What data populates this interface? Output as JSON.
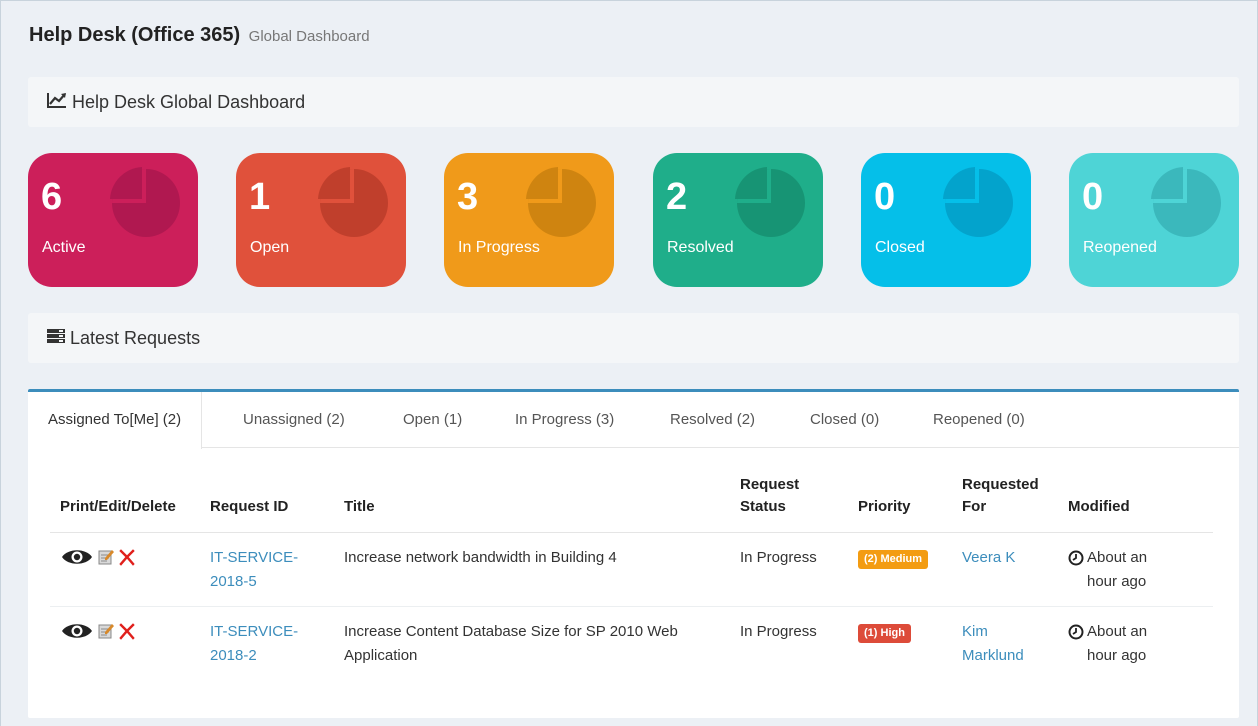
{
  "header": {
    "title": "Help Desk (Office 365)",
    "subtitle": "Global Dashboard"
  },
  "dashboard_section": {
    "title": "Help Desk Global Dashboard",
    "icon": "line-chart-icon"
  },
  "tiles": [
    {
      "count": "6",
      "label": "Active",
      "color": "#cc1f5a",
      "pie_color": "#b01850"
    },
    {
      "count": "1",
      "label": "Open",
      "color": "#e0513b",
      "pie_color": "#c03f2c"
    },
    {
      "count": "3",
      "label": "In Progress",
      "color": "#f09a1a",
      "pie_color": "#cf8410"
    },
    {
      "count": "2",
      "label": "Resolved",
      "color": "#1fae8a",
      "pie_color": "#179474"
    },
    {
      "count": "0",
      "label": "Closed",
      "color": "#05bfe9",
      "pie_color": "#03a3cc"
    },
    {
      "count": "0",
      "label": "Reopened",
      "color": "#4ed4d6",
      "pie_color": "#3bb8bc"
    }
  ],
  "requests_section": {
    "title": "Latest Requests",
    "icon": "server-icon"
  },
  "tabs": [
    {
      "label": "Assigned To[Me] (2)"
    },
    {
      "label": "Unassigned (2)"
    },
    {
      "label": "Open (1)"
    },
    {
      "label": "In Progress (3)"
    },
    {
      "label": "Resolved (2)"
    },
    {
      "label": "Closed (0)"
    },
    {
      "label": "Reopened (0)"
    }
  ],
  "table": {
    "headers": {
      "actions": "Print/Edit/Delete",
      "request_id": "Request ID",
      "title": "Title",
      "status_line1": "Request",
      "status_line2": "Status",
      "priority": "Priority",
      "requested_line1": "Requested",
      "requested_line2": "For",
      "modified": "Modified"
    },
    "rows": [
      {
        "request_id_line1": "IT-SERVICE-",
        "request_id_line2": "2018-5",
        "title": "Increase network bandwidth in Building 4",
        "status": "In Progress",
        "priority": "(2) Medium",
        "priority_color": "#f39c12",
        "requested_for_line1": "Veera K",
        "requested_for_line2": "",
        "modified_line1": "About an",
        "modified_line2": "hour ago"
      },
      {
        "request_id_line1": "IT-SERVICE-",
        "request_id_line2": "2018-2",
        "title": "Increase Content Database Size for SP 2010 Web Application",
        "status": "In Progress",
        "priority": "(1) High",
        "priority_color": "#dd4b39",
        "requested_for_line1": "Kim",
        "requested_for_line2": "Marklund",
        "modified_line1": "About an",
        "modified_line2": "hour ago"
      }
    ]
  },
  "colors": {
    "accent": "#3c8dbc",
    "delete": "#e0201c"
  }
}
